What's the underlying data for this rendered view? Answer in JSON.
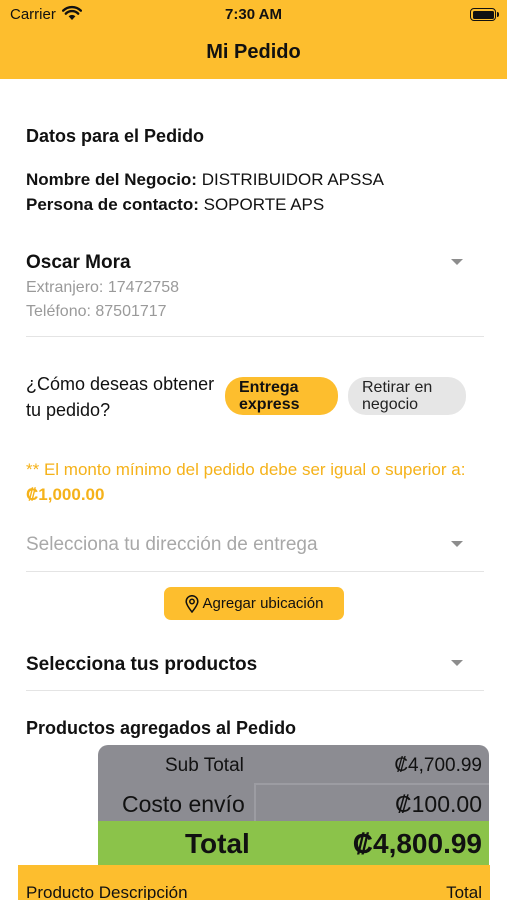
{
  "status_bar": {
    "carrier": "Carrier",
    "time": "7:30 AM"
  },
  "nav": {
    "title": "Mi Pedido"
  },
  "order_data": {
    "heading": "Datos para el Pedido",
    "business_label": "Nombre del Negocio:",
    "business_value": "DISTRIBUIDOR APSSA",
    "contact_label": "Persona de contacto:",
    "contact_value": "SOPORTE APS"
  },
  "customer": {
    "name": "Oscar Mora",
    "id_line": "Extranjero: 17472758",
    "phone_line": "Teléfono: 87501717"
  },
  "delivery": {
    "question": "¿Cómo deseas obtener tu pedido?",
    "options": [
      {
        "label": "Entrega express",
        "selected": true
      },
      {
        "label": "Retirar en negocio",
        "selected": false
      }
    ],
    "minimum_warning": "** El monto mínimo del pedido debe ser igual o superior a:",
    "minimum_amount": "₡1,000.00",
    "address_placeholder": "Selecciona tu dirección de entrega",
    "add_location_label": "Agregar ubicación"
  },
  "products": {
    "select_label": "Selecciona tus productos",
    "added_heading": "Productos agregados al Pedido"
  },
  "totals": {
    "subtotal_label": "Sub Total",
    "subtotal_value": "₡4,700.99",
    "shipping_label": "Costo envío",
    "shipping_value": "₡100.00",
    "total_label": "Total",
    "total_value": "₡4,800.99"
  },
  "table": {
    "col_description": "Producto Descripción",
    "col_total": "Total"
  },
  "colors": {
    "accent": "#FDBE2E",
    "warning_text": "#F5B21A",
    "total_row": "#8BC34A",
    "totals_bg": "#8C8C92"
  }
}
